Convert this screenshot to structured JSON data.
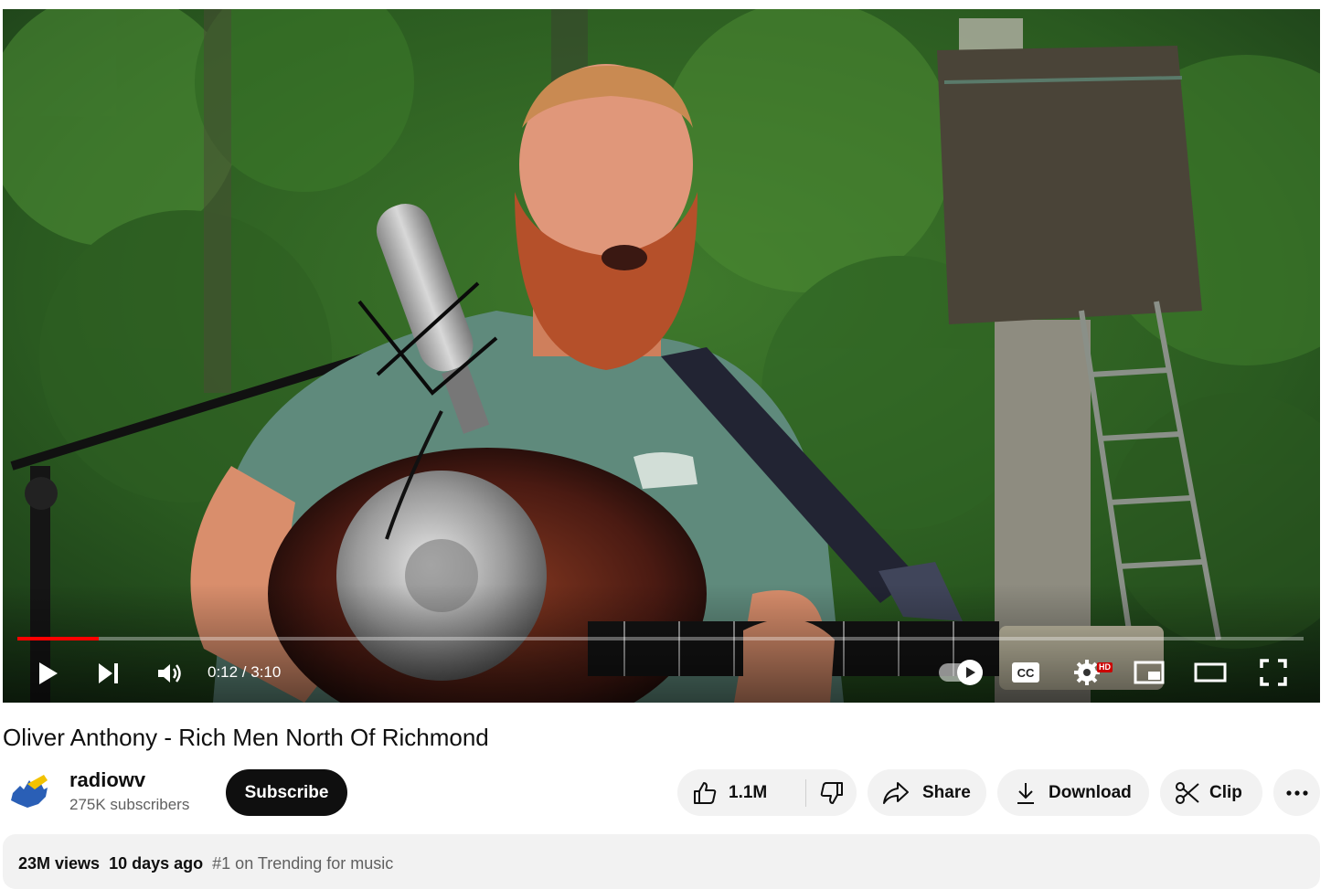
{
  "player": {
    "current_time": "0:12",
    "duration": "3:10",
    "time_display": "0:12 / 3:10",
    "progress_fraction": 0.063,
    "hd_badge": "HD",
    "accent_color": "#ff0000",
    "controls": {
      "play_icon": "play-icon",
      "next_icon": "skip-next-icon",
      "volume_icon": "volume-icon",
      "autoplay_icon": "autoplay-toggle",
      "captions_icon": "closed-captions-icon",
      "settings_icon": "gear-icon",
      "miniplayer_icon": "miniplayer-icon",
      "theater_icon": "theater-mode-icon",
      "fullscreen_icon": "fullscreen-icon"
    }
  },
  "video": {
    "title": "Oliver Anthony - Rich Men North Of Richmond"
  },
  "channel": {
    "name": "radiowv",
    "subscribers": "275K subscribers",
    "subscribe_label": "Subscribe"
  },
  "actions": {
    "like_count": "1.1M",
    "share_label": "Share",
    "download_label": "Download",
    "clip_label": "Clip"
  },
  "description": {
    "views": "23M views",
    "date": "10 days ago",
    "trending": "#1 on Trending for music"
  }
}
